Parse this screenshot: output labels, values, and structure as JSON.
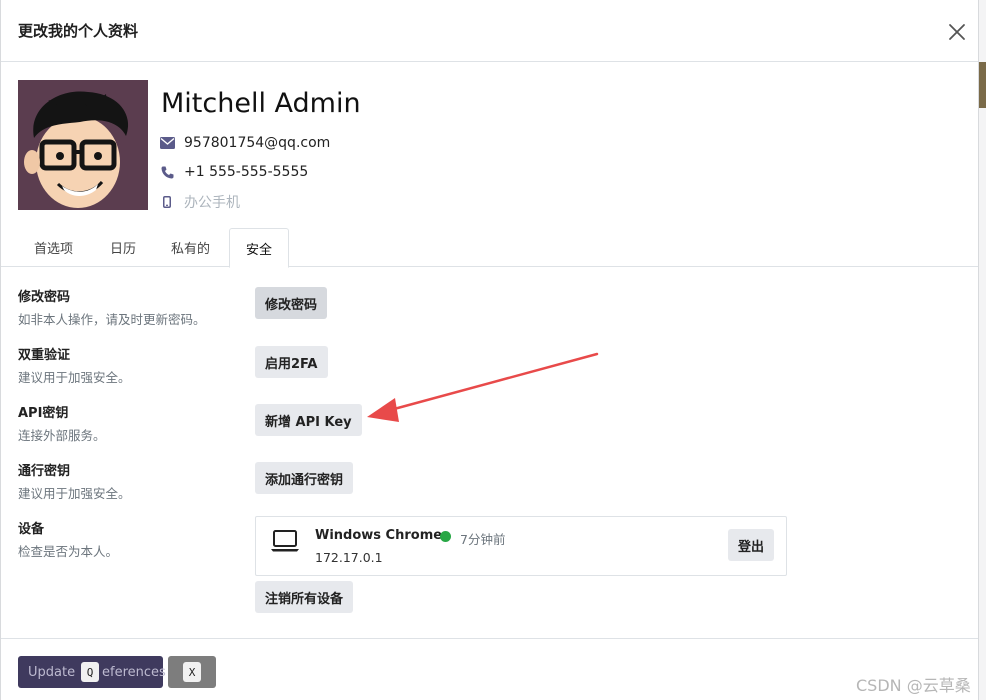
{
  "dialog": {
    "title": "更改我的个人资料"
  },
  "profile": {
    "name": "Mitchell Admin",
    "email": "957801754@qq.com",
    "phone": "+1 555-555-5555",
    "mobile_placeholder": "办公手机"
  },
  "tabs": [
    {
      "label": "首选项",
      "active": false
    },
    {
      "label": "日历",
      "active": false
    },
    {
      "label": "私有的",
      "active": false
    },
    {
      "label": "安全",
      "active": true
    }
  ],
  "security": {
    "password": {
      "title": "修改密码",
      "desc": "如非本人操作，请及时更新密码。",
      "button": "修改密码"
    },
    "twofa": {
      "title": "双重验证",
      "desc": "建议用于加强安全。",
      "button": "启用2FA"
    },
    "api": {
      "title": "API密钥",
      "desc": "连接外部服务。",
      "button": "新增 API Key"
    },
    "passkey": {
      "title": "通行密钥",
      "desc": "建议用于加强安全。",
      "button": "添加通行密钥"
    },
    "devices": {
      "title": "设备",
      "desc": "检查是否为本人。",
      "device_name": "Windows Chrome",
      "time_ago": "7分钟前",
      "ip": "172.17.0.1",
      "logout_button": "登出",
      "revoke_all_button": "注销所有设备"
    }
  },
  "footer": {
    "save_button_left": "Update",
    "save_button_right": "eferences",
    "save_key": "Q",
    "discard_key": "X"
  },
  "watermark": "CSDN @云草桑",
  "colors": {
    "primary": "#3f3a5e",
    "online": "#28a745",
    "icon": "#5b5b8a",
    "arrow": "#e84a4a"
  }
}
